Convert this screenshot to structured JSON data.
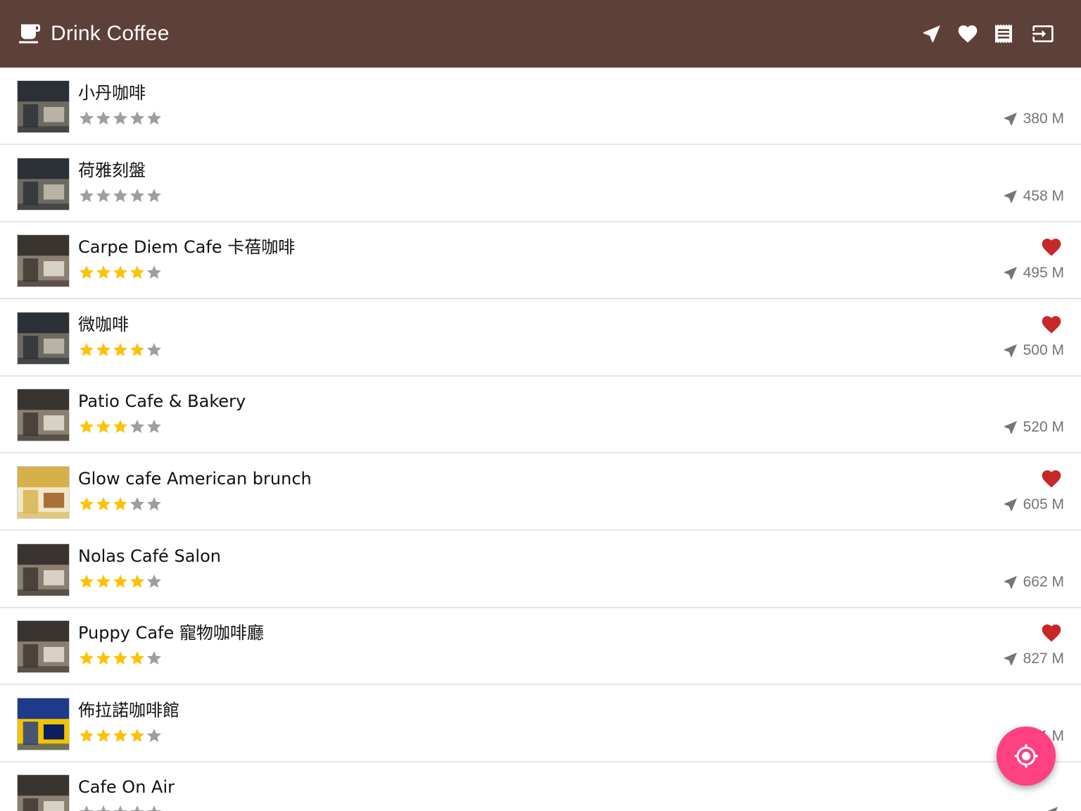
{
  "appbar": {
    "title": "Drink Coffee",
    "app_icon": "coffee-cup-icon",
    "actions": [
      "navigation-icon",
      "favorite-icon",
      "receipt-icon",
      "logout-icon"
    ],
    "background": "#5d4037"
  },
  "colors": {
    "star_filled": "#ffc107",
    "star_empty": "#9e9e9e",
    "heart": "#c62828",
    "fab": "#ff4081",
    "distance_text": "#757575"
  },
  "shops": [
    {
      "name": "小丹咖啡",
      "rating": 0,
      "favorite": false,
      "distance": "380 M",
      "thumb": "storefront-photo"
    },
    {
      "name": "荷雅刻盤",
      "rating": 0,
      "favorite": false,
      "distance": "458 M",
      "thumb": "storefront-photo"
    },
    {
      "name": "Carpe Diem Cafe 卡蓓咖啡",
      "rating": 4,
      "favorite": true,
      "distance": "495 M",
      "thumb": "interior-photo"
    },
    {
      "name": "微咖啡",
      "rating": 4,
      "favorite": true,
      "distance": "500 M",
      "thumb": "storefront-photo"
    },
    {
      "name": "Patio Cafe & Bakery",
      "rating": 3,
      "favorite": false,
      "distance": "520 M",
      "thumb": "interior-photo"
    },
    {
      "name": "Glow cafe American brunch",
      "rating": 3,
      "favorite": true,
      "distance": "605 M",
      "thumb": "food-photo"
    },
    {
      "name": "Nolas Café Salon",
      "rating": 4,
      "favorite": false,
      "distance": "662 M",
      "thumb": "interior-photo"
    },
    {
      "name": "Puppy Cafe 寵物咖啡廳",
      "rating": 4,
      "favorite": true,
      "distance": "827 M",
      "thumb": "interior-photo"
    },
    {
      "name": "佈拉諾咖啡館",
      "rating": 4,
      "favorite": false,
      "distance": "M",
      "thumb": "sign-photo"
    },
    {
      "name": "Cafe On Air",
      "rating": 0,
      "favorite": false,
      "distance": "",
      "thumb": "interior-photo"
    }
  ],
  "fab": {
    "icon": "my-location-icon"
  }
}
